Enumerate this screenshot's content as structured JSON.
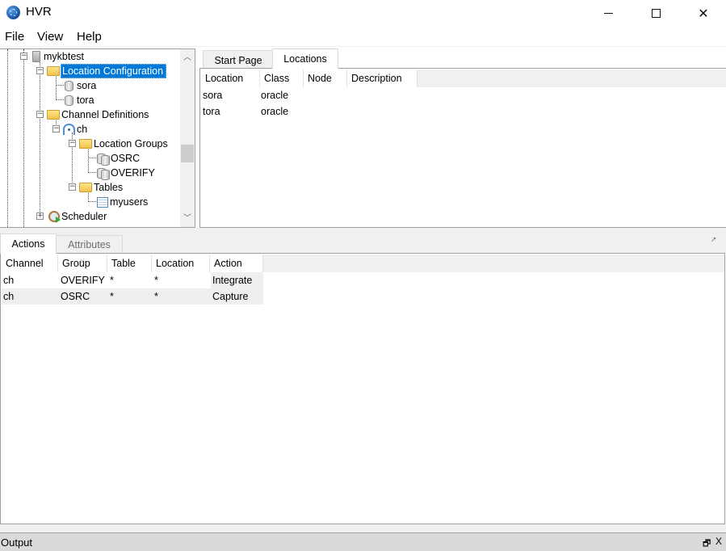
{
  "window": {
    "title": "HVR",
    "controls": {
      "minimize": "minimize",
      "maximize": "maximize",
      "close": "✕"
    }
  },
  "menu": [
    "File",
    "View",
    "Help"
  ],
  "tree": {
    "nodes": [
      {
        "label": "mykbtest",
        "icon": "server-icon",
        "expander": "−"
      },
      {
        "label": "Location Configuration",
        "icon": "folder-icon",
        "expander": "−",
        "selected": true
      },
      {
        "label": "sora",
        "icon": "database-icon"
      },
      {
        "label": "tora",
        "icon": "database-icon"
      },
      {
        "label": "Channel Definitions",
        "icon": "folder-icon",
        "expander": "−"
      },
      {
        "label": "ch",
        "icon": "channel-icon",
        "expander": "−"
      },
      {
        "label": "Location Groups",
        "icon": "folder-icon",
        "expander": "−"
      },
      {
        "label": "OSRC",
        "icon": "database-group-icon"
      },
      {
        "label": "OVERIFY",
        "icon": "database-group-icon"
      },
      {
        "label": "Tables",
        "icon": "folder-icon",
        "expander": "−"
      },
      {
        "label": "myusers",
        "icon": "table-icon"
      },
      {
        "label": "Scheduler",
        "icon": "scheduler-icon",
        "expander": "+"
      }
    ]
  },
  "content_tabs": [
    {
      "label": "Start Page",
      "active": false
    },
    {
      "label": "Locations",
      "active": true
    }
  ],
  "locations_table": {
    "columns": [
      "Location",
      "Class",
      "Node",
      "Description"
    ],
    "rows": [
      [
        "sora",
        "oracle",
        "",
        ""
      ],
      [
        "tora",
        "oracle",
        "",
        ""
      ]
    ]
  },
  "bottom_tabs": [
    {
      "label": "Actions",
      "active": true
    },
    {
      "label": "Attributes",
      "active": false
    }
  ],
  "actions_table": {
    "columns": [
      "Channel",
      "Group",
      "Table",
      "Location",
      "Action"
    ],
    "sort_indicator": "˅",
    "rows": [
      [
        "ch",
        "OVERIFY",
        "*",
        "*",
        "Integrate"
      ],
      [
        "ch",
        "OSRC",
        "*",
        "*",
        "Capture"
      ]
    ]
  },
  "output_panel": {
    "title": "Output",
    "float_label": "🗗",
    "close_label": "X"
  },
  "colors": {
    "selection": "#0078d7",
    "pane_bg": "#f0f0f0",
    "output_bar": "#dadada"
  }
}
